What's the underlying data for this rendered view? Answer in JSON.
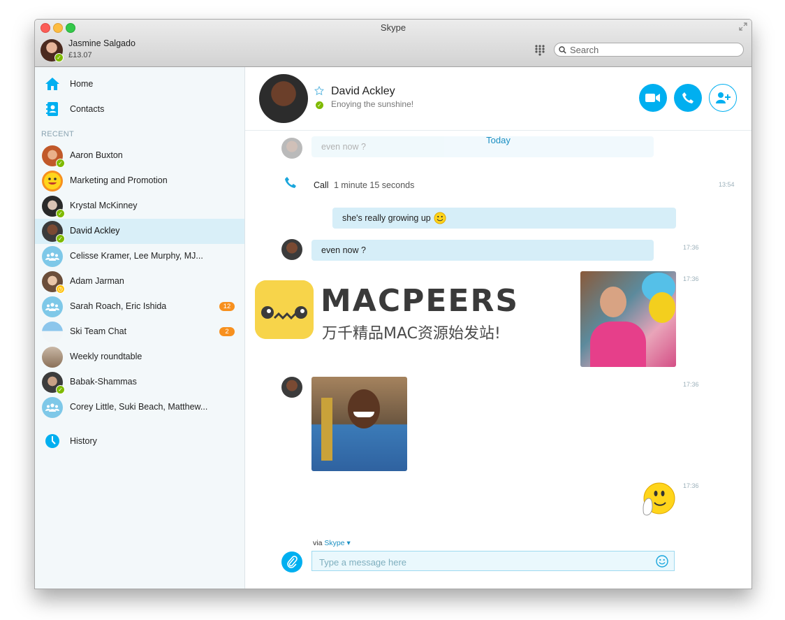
{
  "window": {
    "title": "Skype"
  },
  "account": {
    "name": "Jasmine Salgado",
    "credit": "£13.07"
  },
  "search": {
    "placeholder": "Search"
  },
  "nav": {
    "home": "Home",
    "contacts": "Contacts",
    "history": "History"
  },
  "recent_header": "RECENT",
  "recent": [
    {
      "name": "Aaron Buxton",
      "status": "online"
    },
    {
      "name": "Marketing and Promotion",
      "status": ""
    },
    {
      "name": "Krystal McKinney",
      "status": "online"
    },
    {
      "name": "David Ackley",
      "status": "online",
      "active": true
    },
    {
      "name": "Celisse Kramer, Lee Murphy, MJ...",
      "status": ""
    },
    {
      "name": "Adam Jarman",
      "status": "away"
    },
    {
      "name": "Sarah Roach, Eric Ishida",
      "badge": "12"
    },
    {
      "name": "Ski Team Chat",
      "badge": "2"
    },
    {
      "name": "Weekly roundtable",
      "status": ""
    },
    {
      "name": "Babak-Shammas",
      "status": "online"
    },
    {
      "name": "Corey Little, Suki Beach, Matthew...",
      "status": ""
    }
  ],
  "conversation": {
    "name": "David Ackley",
    "mood": "Enoying the sunshine!",
    "date_separator": "Today",
    "faded_message": "even now ?",
    "call": {
      "label": "Call",
      "duration": "1 minute 15 seconds",
      "time": "13:54"
    },
    "messages": [
      {
        "text": "she's really growing up",
        "time": ""
      },
      {
        "text": "even now ?",
        "time": "17:36"
      }
    ],
    "photo_times": [
      "17:36",
      "17:36"
    ],
    "emoticon_time": "17:36"
  },
  "watermark": {
    "title": "MACPEERS",
    "subtitle": "万千精品MAC资源始发站!"
  },
  "compose": {
    "via_prefix": "via ",
    "via_service": "Skype",
    "placeholder": "Type a message here"
  },
  "colors": {
    "accent": "#00aff0",
    "bubble": "#d6eef8",
    "presence": "#7fba00",
    "badge": "#f7901e"
  }
}
